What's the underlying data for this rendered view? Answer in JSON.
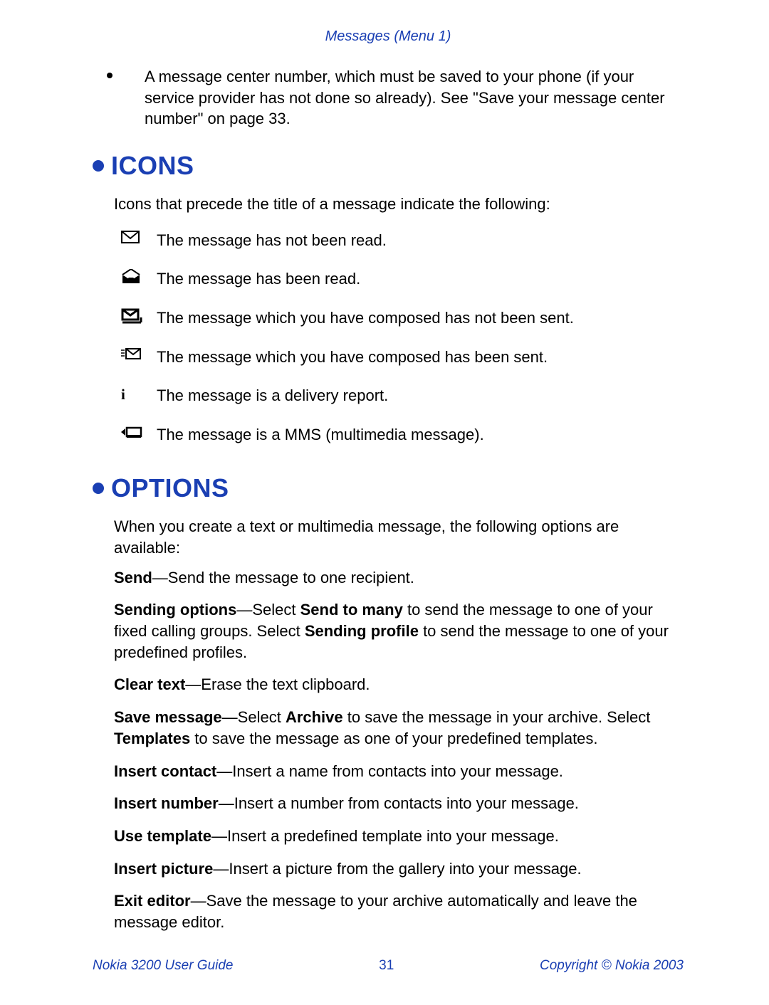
{
  "header": "Messages (Menu 1)",
  "topBullet": "A message center number, which must be saved to your phone (if your service provider has not done so already). See \"Save your message center number\" on page 33.",
  "sections": {
    "icons": {
      "title": "ICONS",
      "intro": "Icons that precede the title of a message indicate the following:",
      "items": [
        {
          "name": "unread-envelope-icon",
          "label": "The message has not been read."
        },
        {
          "name": "read-envelope-icon",
          "label": "The message has been read."
        },
        {
          "name": "draft-unsent-icon",
          "label": "The message which you have composed has not been sent."
        },
        {
          "name": "sent-envelope-icon",
          "label": "The message which you have composed has been sent."
        },
        {
          "name": "delivery-report-icon",
          "label": "The message is a delivery report."
        },
        {
          "name": "mms-icon",
          "label": "The message is a MMS (multimedia message)."
        }
      ]
    },
    "options": {
      "title": "OPTIONS",
      "intro": "When you create a text or multimedia message, the following options are available:",
      "items": [
        {
          "bold": "Send",
          "rest": "—Send the message to one recipient."
        },
        {
          "html": "<b>Sending options</b>—Select <b>Send to many</b> to send the message to one of your fixed calling groups. Select <b>Sending profile</b> to send the message to one of your predefined profiles."
        },
        {
          "bold": "Clear text",
          "rest": "—Erase the text clipboard."
        },
        {
          "html": "<b>Save message</b>—Select <b>Archive</b> to save the message in your archive. Select <b>Templates</b> to save the message as one of your predefined templates."
        },
        {
          "bold": "Insert contact",
          "rest": "—Insert a name from contacts into your message."
        },
        {
          "bold": "Insert number",
          "rest": "—Insert a number from contacts into your message."
        },
        {
          "bold": "Use template",
          "rest": "—Insert a predefined template into your message."
        },
        {
          "bold": "Insert picture",
          "rest": "—Insert a picture from the gallery into your message."
        },
        {
          "bold": "Exit editor",
          "rest": "—Save the message to your archive automatically and leave the message editor."
        }
      ]
    }
  },
  "footer": {
    "left": "Nokia 3200 User Guide",
    "center": "31",
    "right": "Copyright © Nokia 2003"
  }
}
